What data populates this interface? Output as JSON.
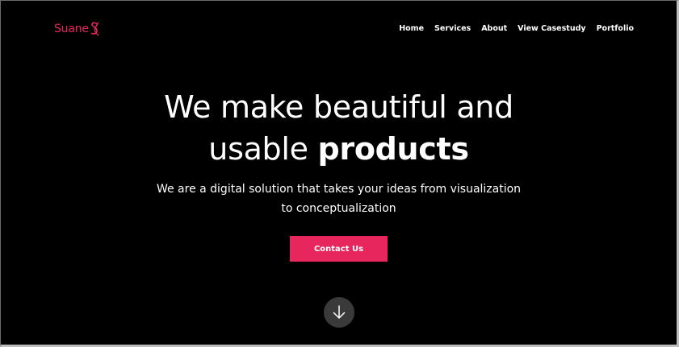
{
  "header": {
    "logo_text": "Suane",
    "nav": [
      {
        "label": "Home"
      },
      {
        "label": "Services"
      },
      {
        "label": "About"
      },
      {
        "label": "View Casestudy"
      },
      {
        "label": "Portfolio"
      }
    ]
  },
  "hero": {
    "headline_line1": "We make beautiful and",
    "headline_line2_regular": "usable ",
    "headline_line2_bold": "products",
    "subtitle_line1": "We are a digital solution that takes your ideas from visualization",
    "subtitle_line2": "to conceptualization",
    "cta_label": "Contact Us",
    "scroll_icon": "arrow-down-icon"
  },
  "colors": {
    "background": "#000000",
    "accent": "#e8265e",
    "text": "#ffffff",
    "scroll_button": "#3a3a3a"
  }
}
